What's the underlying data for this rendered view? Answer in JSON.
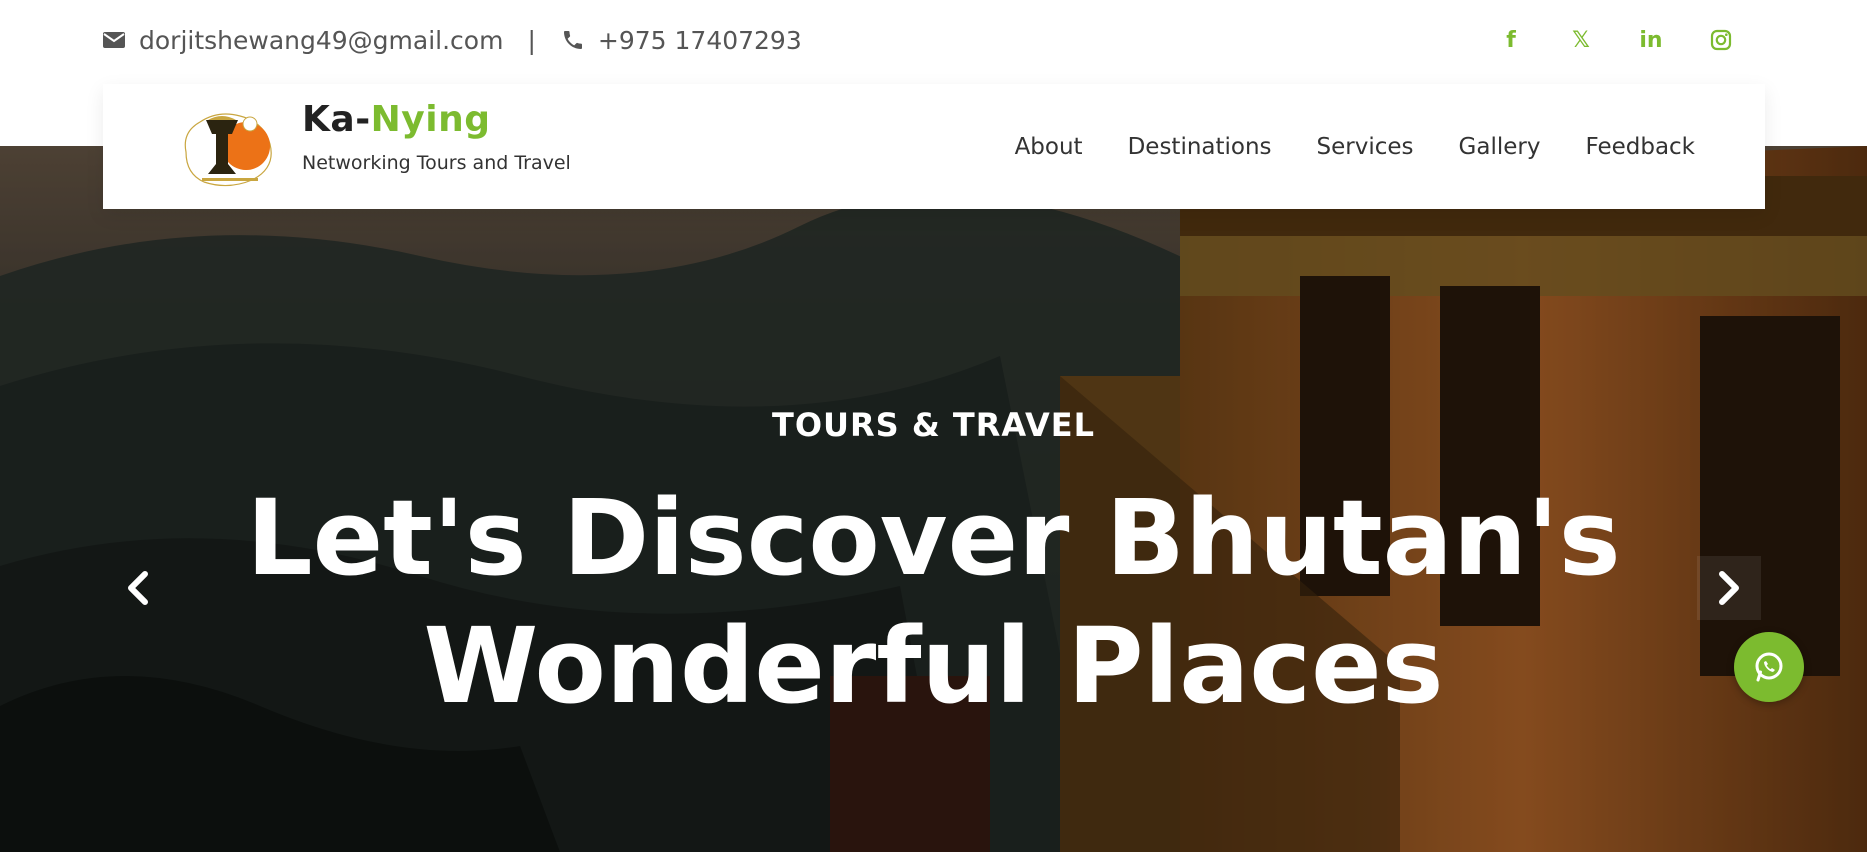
{
  "contact": {
    "email": "dorjitshewang49@gmail.com",
    "separator": "|",
    "phone": "+975 17407293",
    "email_icon": "envelope-icon",
    "phone_icon": "phone-icon"
  },
  "social": [
    {
      "name": "facebook-icon",
      "glyph": "f"
    },
    {
      "name": "x-twitter-icon",
      "glyph": "𝕏"
    },
    {
      "name": "linkedin-icon",
      "glyph": "in"
    },
    {
      "name": "instagram-icon",
      "glyph": "◎"
    }
  ],
  "brand": {
    "name_part1": "Ka-",
    "name_part2": "Nying",
    "tagline": "Networking Tours and Travel"
  },
  "nav": {
    "items": [
      "About",
      "Destinations",
      "Services",
      "Gallery",
      "Feedback"
    ]
  },
  "hero": {
    "kicker": "TOURS & TRAVEL",
    "headline_line1": "Let's Discover Bhutan's",
    "headline_line2": "Wonderful Places",
    "prev_icon": "chevron-left-icon",
    "next_icon": "chevron-right-icon"
  },
  "whatsapp": {
    "icon": "whatsapp-icon"
  },
  "colors": {
    "accent": "#7cbb2f",
    "text_dark": "#333333",
    "hero_text": "#ffffff"
  }
}
